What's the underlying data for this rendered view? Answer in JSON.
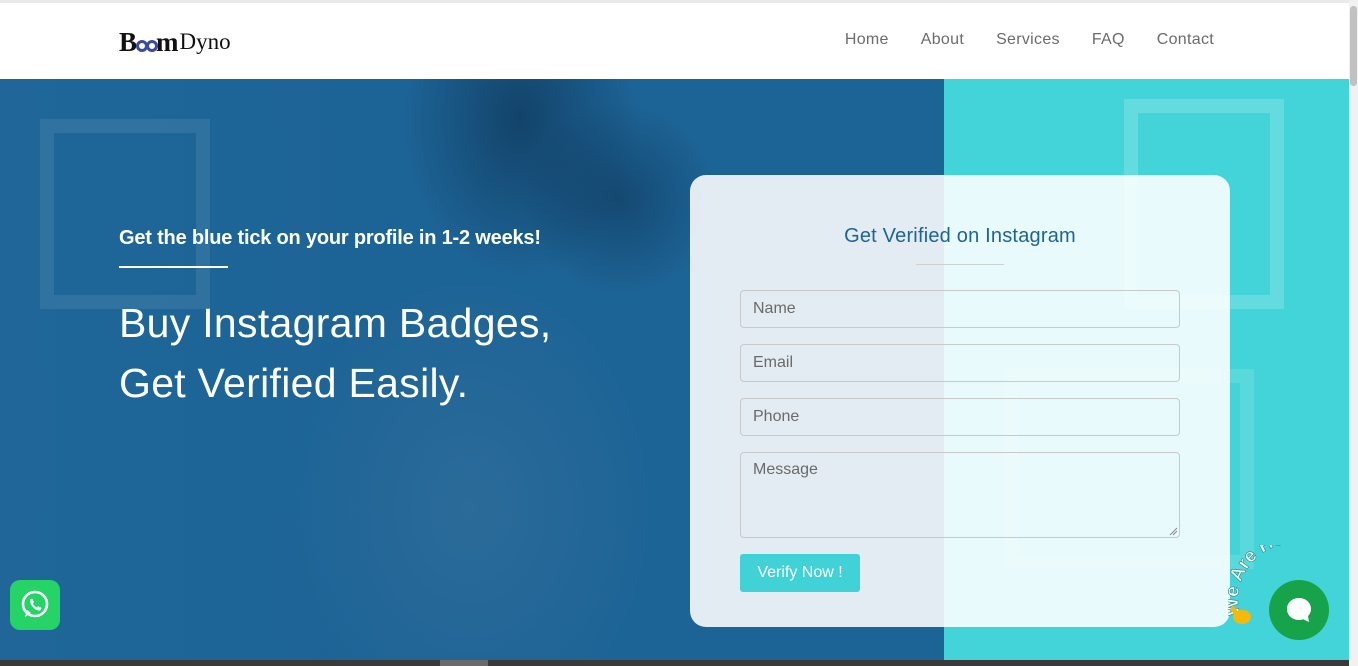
{
  "brand": {
    "logo_text_b": "B",
    "logo_text_m": "m",
    "logo_text_dyno": "Dyno"
  },
  "nav": {
    "items": [
      {
        "label": "Home"
      },
      {
        "label": "About"
      },
      {
        "label": "Services"
      },
      {
        "label": "FAQ"
      },
      {
        "label": "Contact"
      }
    ]
  },
  "hero": {
    "tagline": "Get the blue tick on your profile in 1-2 weeks!",
    "headline_line1": "Buy Instagram Badges,",
    "headline_line2": "Get Verified Easily."
  },
  "form": {
    "title": "Get Verified on Instagram",
    "name_placeholder": "Name",
    "email_placeholder": "Email",
    "phone_placeholder": "Phone",
    "message_placeholder": "Message",
    "submit_label": "Verify Now !"
  },
  "chat": {
    "badge_text": "We Are Here!"
  },
  "colors": {
    "hero_blue": "#1d6496",
    "hero_teal": "#42d4d8",
    "accent": "#40d2d6",
    "title_blue": "#1d6496",
    "whatsapp_green": "#25d366",
    "chat_green": "#17a34a"
  }
}
